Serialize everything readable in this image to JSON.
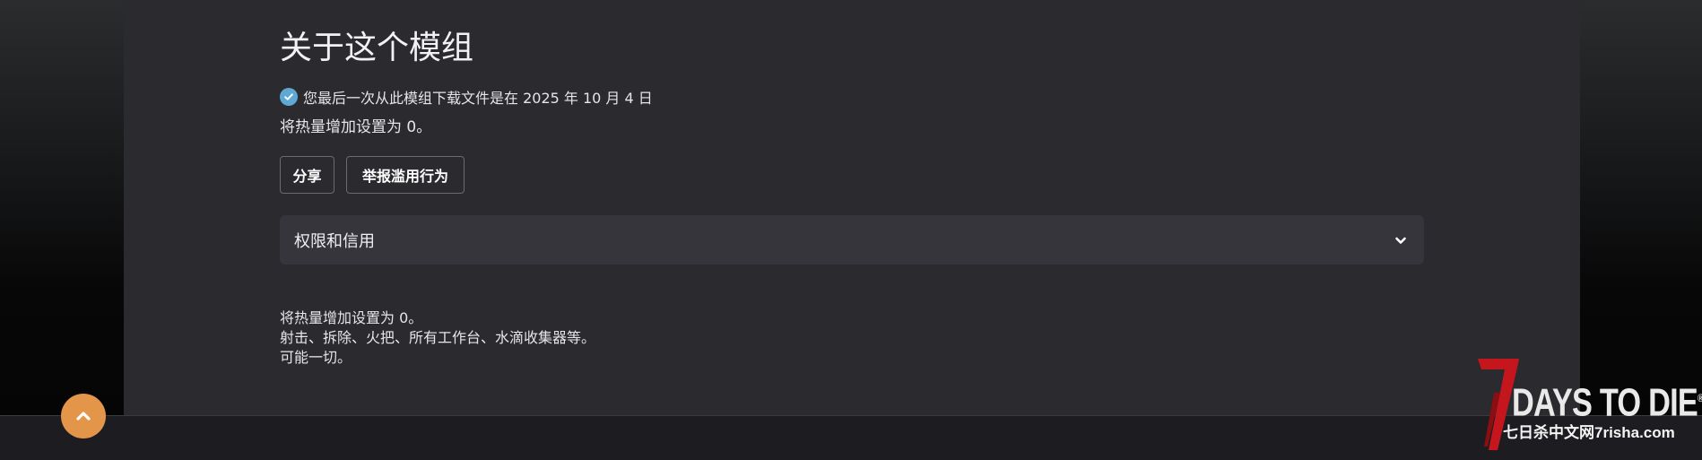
{
  "section": {
    "title": "关于这个模组"
  },
  "download_notice": {
    "icon": "check-circle-icon",
    "text": "您最后一次从此模组下载文件是在 2025 年 10 月 4 日"
  },
  "summary": "将热量增加设置为 0。",
  "actions": {
    "share_label": "分享",
    "report_label": "举报滥用行为"
  },
  "accordion": {
    "label": "权限和信用",
    "icon": "chevron-down-icon"
  },
  "description": {
    "lines": [
      "将热量增加设置为 0。",
      "射击、拆除、火把、所有工作台、水滴收集器等。",
      "可能一切。"
    ]
  },
  "scroll_top": {
    "icon": "chevron-up-icon"
  },
  "watermark": {
    "seven": "7",
    "title": "DAYS TO DIE",
    "registered": "®",
    "subtitle": "七日杀中文网7risha.com"
  },
  "colors": {
    "panel": "#2a2a2f",
    "accordion": "#35353b",
    "check": "#5fa8d3",
    "scroll_button": "#e3964a",
    "logo_red": "#c4161c"
  }
}
